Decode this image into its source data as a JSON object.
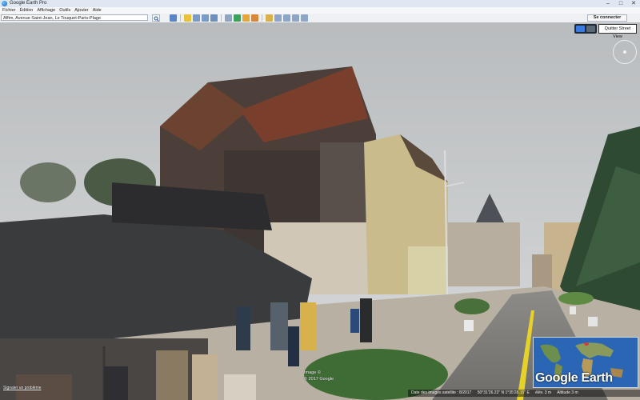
{
  "window": {
    "title": "Google Earth Pro",
    "minimize": "–",
    "maximize": "□",
    "close": "✕"
  },
  "menu": [
    {
      "label": "Fichier"
    },
    {
      "label": "Édition"
    },
    {
      "label": "Affichage"
    },
    {
      "label": "Outils"
    },
    {
      "label": "Ajouter"
    },
    {
      "label": "Aide"
    }
  ],
  "search": {
    "value": "Affim, Avenue Saint-Jean, Le Touquet-Paris-Plage",
    "button_icon": "search-icon"
  },
  "toolbar": {
    "icons": [
      {
        "name": "sidebar-toggle-icon",
        "color": "#5b84c4"
      },
      {
        "name": "add-placemark-icon",
        "color": "#e8c23a"
      },
      {
        "name": "add-polygon-icon",
        "color": "#7a9bc8"
      },
      {
        "name": "add-path-icon",
        "color": "#7a9bc8"
      },
      {
        "name": "add-image-overlay-icon",
        "color": "#6d8fbb"
      },
      {
        "name": "record-tour-icon",
        "color": "#8fa5c2"
      },
      {
        "name": "historical-imagery-icon",
        "color": "#3da05b"
      },
      {
        "name": "sunlight-icon",
        "color": "#e8a63a"
      },
      {
        "name": "planets-icon",
        "color": "#d6883b"
      },
      {
        "name": "ruler-icon",
        "color": "#d9b14a"
      },
      {
        "name": "email-icon",
        "color": "#8ea6c6"
      },
      {
        "name": "print-icon",
        "color": "#8ea6c6"
      },
      {
        "name": "save-image-icon",
        "color": "#8ea6c6"
      },
      {
        "name": "view-in-maps-icon",
        "color": "#8ea6c6"
      }
    ],
    "sign_in_label": "Se connecter"
  },
  "streetview": {
    "exit_label": "Quitter Street View"
  },
  "overlay": {
    "copyright_line1": "Image ©",
    "copyright_line2": "© 2017 Google",
    "brand": "Google Earth",
    "feedback_link": "Signaler un problème"
  },
  "status": {
    "imagery_date": "Date des images satellite : 8/2017",
    "coordinates": "50°31'26.23\" N   1°35'28.15\" E",
    "elevation": "élév.   3 m",
    "altitude": "Altitude   3 m"
  },
  "colors": {
    "earth_blue": "#2b66b5",
    "toolbar_bg": "#eef0f3"
  }
}
